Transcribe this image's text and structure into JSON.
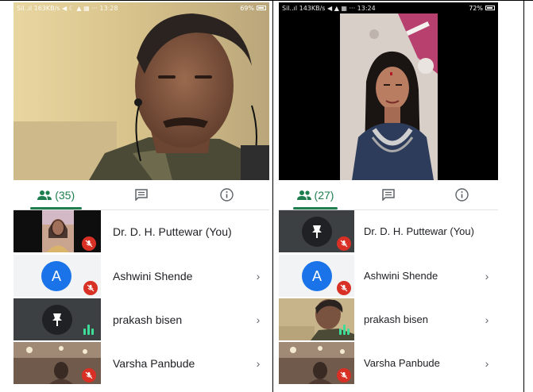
{
  "left_phone": {
    "status": {
      "left": "Sil..ıl 163KB/s ◀ ☾ ▲ ▦ ··· 13:28",
      "right": "69%"
    },
    "tabs": {
      "people_count": "(35)"
    },
    "participants": [
      {
        "name": "Dr. D. H. Puttewar (You)",
        "chevron": ""
      },
      {
        "name": "Ashwini Shende",
        "avatar_letter": "A",
        "chevron": "›"
      },
      {
        "name": "prakash bisen",
        "chevron": "›"
      },
      {
        "name": "Varsha Panbude",
        "chevron": "›"
      }
    ]
  },
  "right_phone": {
    "status": {
      "left": "Sil..ıl 143KB/s ◀ ▲ ▦ ··· 13:24",
      "right": "72%"
    },
    "tabs": {
      "people_count": "(27)"
    },
    "participants": [
      {
        "name": "Dr. D. H. Puttewar (You)",
        "chevron": ""
      },
      {
        "name": "Ashwini Shende",
        "avatar_letter": "A",
        "chevron": "›"
      },
      {
        "name": "prakash bisen",
        "chevron": "›"
      },
      {
        "name": "Varsha Panbude",
        "chevron": "›"
      }
    ]
  },
  "colors": {
    "accent_green": "#1e7e4e",
    "mute_red": "#d93025",
    "avatar_blue": "#1a73e8",
    "speaking_bars": "#3ddc97"
  },
  "icons": [
    "people-icon",
    "chat-icon",
    "info-icon",
    "mic-off-icon",
    "pin-icon",
    "speaking-icon",
    "chevron-right-icon"
  ]
}
